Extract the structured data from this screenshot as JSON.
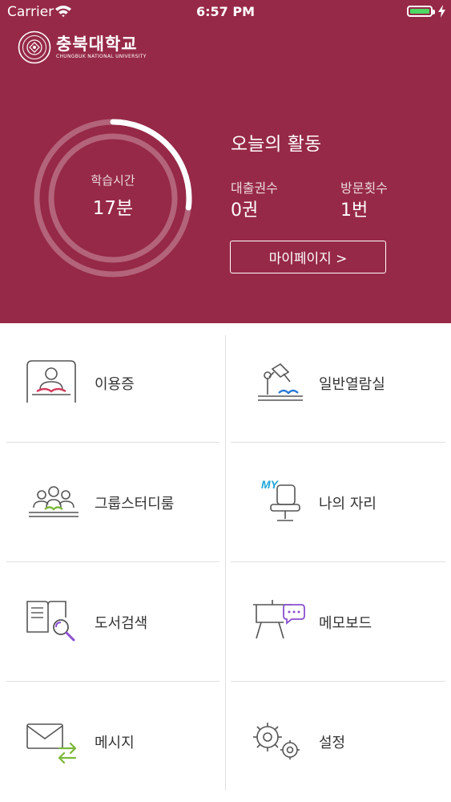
{
  "status_bar": {
    "carrier": "Carrier",
    "time": "6:57 PM"
  },
  "logo": {
    "name_ko": "충북대학교",
    "name_en": "CHUNGBUK NATIONAL UNIVERSITY"
  },
  "study": {
    "label": "학습시간",
    "value": "17분",
    "progress": 0.27
  },
  "activity": {
    "title": "오늘의 활동",
    "loans_label": "대출권수",
    "loans_value": "0권",
    "visits_label": "방문횟수",
    "visits_value": "1번",
    "mypage_button": "마이페이지 >"
  },
  "menu": [
    {
      "label": "이용증",
      "icon": "library-card-icon"
    },
    {
      "label": "일반열람실",
      "icon": "reading-lamp-icon"
    },
    {
      "label": "그룹스터디룸",
      "icon": "group-study-icon"
    },
    {
      "label": "나의 자리",
      "icon": "my-seat-icon",
      "badge": "MY"
    },
    {
      "label": "도서검색",
      "icon": "book-search-icon"
    },
    {
      "label": "메모보드",
      "icon": "memo-board-icon"
    },
    {
      "label": "메시지",
      "icon": "message-icon"
    },
    {
      "label": "설정",
      "icon": "settings-gear-icon"
    }
  ],
  "colors": {
    "brand": "#962947",
    "accent_blue": "#2a7ad5",
    "accent_green": "#7cb83a",
    "accent_purple": "#8a4fd0",
    "accent_cyan": "#1aa6d9"
  }
}
